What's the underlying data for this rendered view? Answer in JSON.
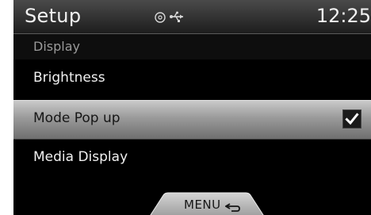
{
  "status_bar": {
    "title": "Setup",
    "clock": "12:25"
  },
  "section": {
    "label": "Display"
  },
  "items": [
    {
      "label": "Brightness",
      "selected": false
    },
    {
      "label": "Mode Pop up",
      "selected": true,
      "checked": true
    },
    {
      "label": "Media Display",
      "selected": false
    }
  ],
  "menu_button": {
    "label": "MENU"
  },
  "icons": {
    "status": [
      "disc-icon",
      "usb-icon"
    ],
    "checkbox": "checkmark-icon",
    "menu": "back-arrow-icon"
  },
  "colors": {
    "background": "#000000",
    "selected_row": "#9a9a9a",
    "text": "#f0f0f0",
    "selected_text": "#161616"
  }
}
